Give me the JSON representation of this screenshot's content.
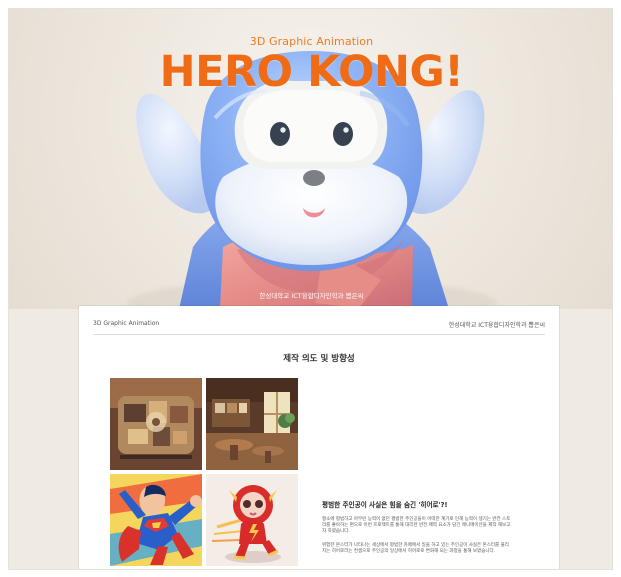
{
  "hero": {
    "subtitle": "3D Graphic Animation",
    "title": "HERO KONG!",
    "credit": "한성대학교 ICT융합디자인학과 뽑은씨"
  },
  "sheet": {
    "left_label": "3D Graphic Animation",
    "right_label": "한성대학교 ICT융합디자인학과 뽑은씨",
    "section_title": "제작 의도 및 방향성",
    "copy_title": "평범한 주인공이 사실은 힘을 숨긴 '히어로'?!",
    "paragraph_1": "평소에 평범하고 아무런 능력이 없던 평범한 주인공들이 어떠한 계기로 인해 능력이 생기는 반전 스토리를 좋아하는 편으로 이번 프로젝트를 통해 대리한 반전 매력 요소가 담긴 애니메이션을 제작 해보고자 하였습니다.",
    "paragraph_2": "위험한 몬스터가 나타나는 세상에서 평범한 카페에서 일을 하고 있는 주인공이 사실은 몬스터를 물리치는 히어로라는 컨셉으로 주인공의 일상에서 히어로로 변화해 되는 과정을 통해 보였습니다."
  },
  "colors": {
    "accent": "#f06b16",
    "hero_background": "#efebe4",
    "character_blue": "#86acf0",
    "scarf_pink": "#e9888c"
  },
  "icons": {
    "hero_character": "hero-kong-character",
    "mini_city": "city-diorama-image",
    "cafe": "cafe-interior-image",
    "superman": "superman-comic-image",
    "flash": "flash-figure-image"
  }
}
